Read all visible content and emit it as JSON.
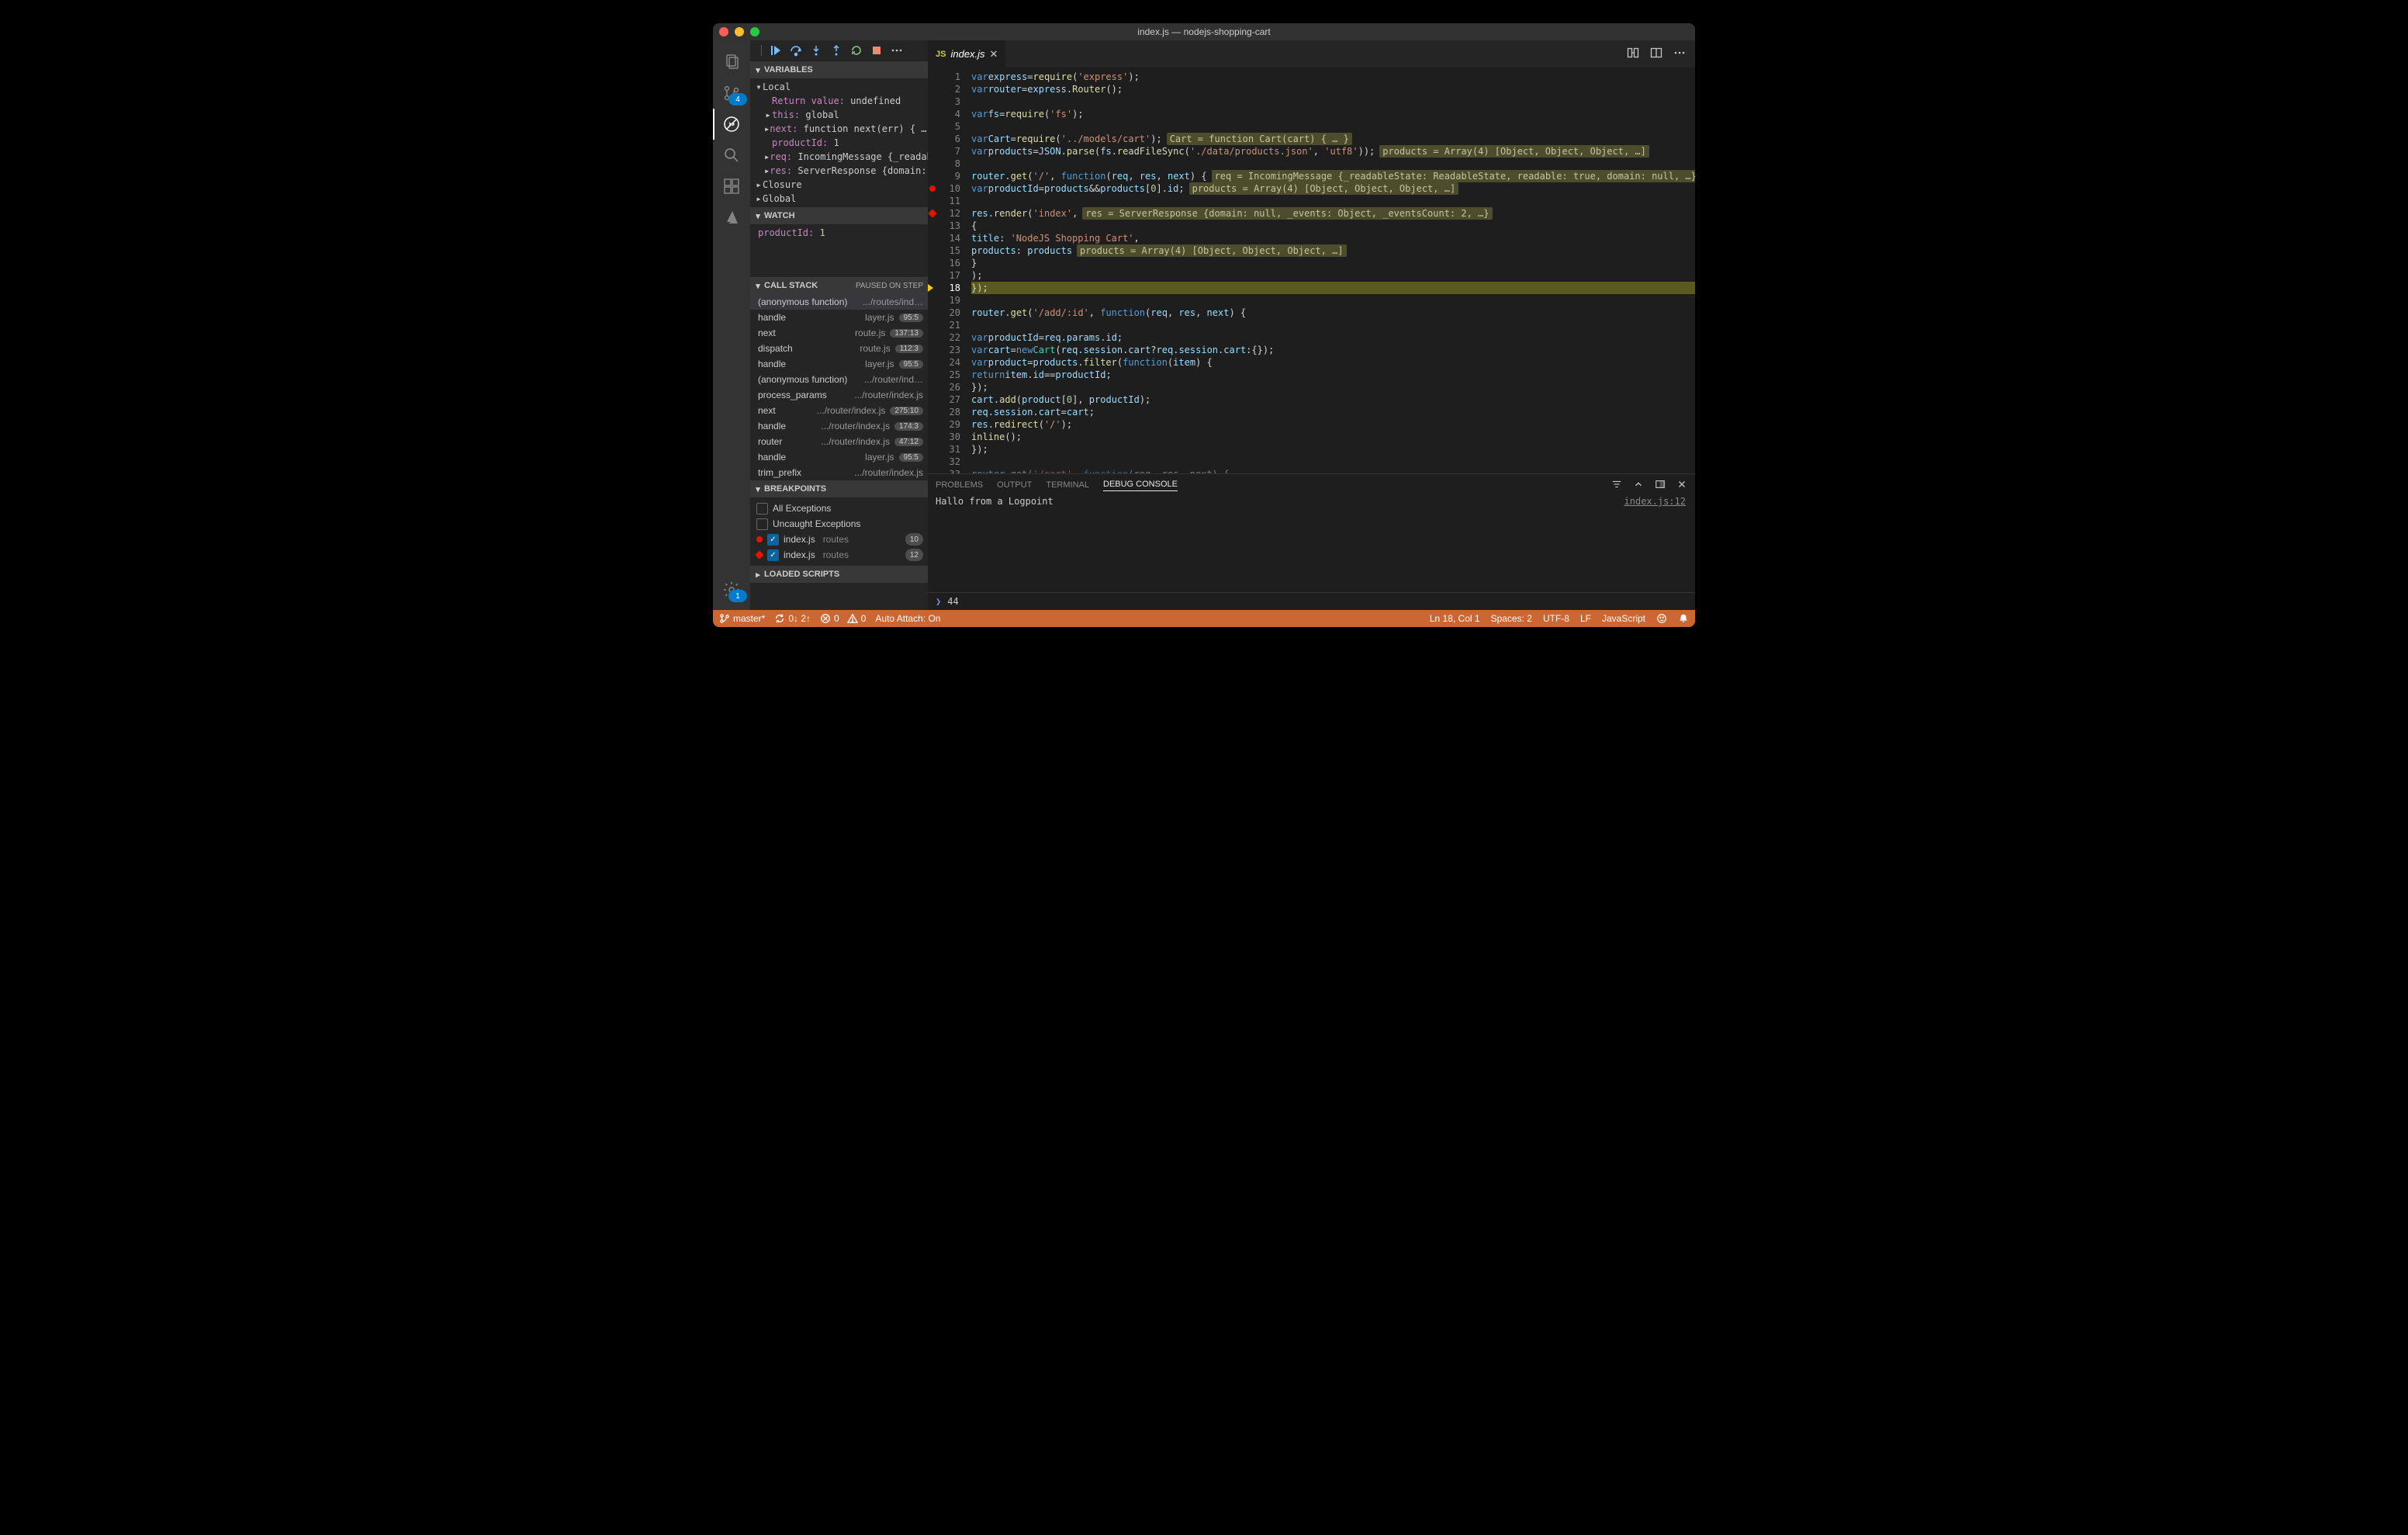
{
  "window": {
    "title": "index.js — nodejs-shopping-cart"
  },
  "activitybar": {
    "scm_badge": "4",
    "settings_badge": "1"
  },
  "sidebar": {
    "sections": {
      "variables": "VARIABLES",
      "watch": "WATCH",
      "callstack": "CALL STACK",
      "callstack_status": "PAUSED ON STEP",
      "breakpoints": "BREAKPOINTS",
      "loaded": "LOADED SCRIPTS"
    },
    "variables": {
      "scopes": [
        {
          "name": "Local",
          "expanded": true
        },
        {
          "name": "Closure",
          "expanded": false
        },
        {
          "name": "Global",
          "expanded": false
        }
      ],
      "local": [
        {
          "label": "Return value:",
          "value": "undefined"
        },
        {
          "label": "this:",
          "value": "global"
        },
        {
          "label": "next:",
          "value": "function next(err) { … }"
        },
        {
          "label": "productId:",
          "value": "1"
        },
        {
          "label": "req:",
          "value": "IncomingMessage {_readableSt…"
        },
        {
          "label": "res:",
          "value": "ServerResponse {domain: null…"
        }
      ]
    },
    "watch": [
      {
        "label": "productId:",
        "value": "1"
      }
    ],
    "callstack": [
      {
        "name": "(anonymous function)",
        "file": ".../routes/ind…",
        "pos": ""
      },
      {
        "name": "handle",
        "file": "layer.js",
        "pos": "95:5"
      },
      {
        "name": "next",
        "file": "route.js",
        "pos": "137:13"
      },
      {
        "name": "dispatch",
        "file": "route.js",
        "pos": "112:3"
      },
      {
        "name": "handle",
        "file": "layer.js",
        "pos": "95:5"
      },
      {
        "name": "(anonymous function)",
        "file": ".../router/ind…",
        "pos": ""
      },
      {
        "name": "process_params",
        "file": ".../router/index.js",
        "pos": ""
      },
      {
        "name": "next",
        "file": ".../router/index.js",
        "pos": "275:10"
      },
      {
        "name": "handle",
        "file": ".../router/index.js",
        "pos": "174:3"
      },
      {
        "name": "router",
        "file": ".../router/index.js",
        "pos": "47:12"
      },
      {
        "name": "handle",
        "file": "layer.js",
        "pos": "95:5"
      },
      {
        "name": "trim_prefix",
        "file": ".../router/index.js",
        "pos": ""
      }
    ],
    "breakpoints": {
      "allExceptions": "All Exceptions",
      "uncaught": "Uncaught Exceptions",
      "list": [
        {
          "file": "index.js",
          "dir": "routes",
          "line": "10",
          "shape": "circle"
        },
        {
          "file": "index.js",
          "dir": "routes",
          "line": "12",
          "shape": "diamond"
        }
      ]
    }
  },
  "tabs": {
    "active": "index.js"
  },
  "editor": {
    "current_line": 18,
    "lines": [
      {
        "n": 1,
        "html": "<span class='tok-kw'>var</span> <span class='tok-var'>express</span> <span class='tok-plain'>=</span> <span class='tok-fn'>require</span><span class='tok-plain'>(</span><span class='tok-str'>'express'</span><span class='tok-plain'>);</span>"
      },
      {
        "n": 2,
        "html": "<span class='tok-kw'>var</span> <span class='tok-var'>router</span> <span class='tok-plain'>=</span> <span class='tok-var'>express</span><span class='tok-plain'>.</span><span class='tok-fn'>Router</span><span class='tok-plain'>();</span>"
      },
      {
        "n": 3,
        "html": ""
      },
      {
        "n": 4,
        "html": "<span class='tok-kw'>var</span> <span class='tok-var'>fs</span> <span class='tok-plain'>=</span> <span class='tok-fn'>require</span><span class='tok-plain'>(</span><span class='tok-str'>'fs'</span><span class='tok-plain'>);</span>"
      },
      {
        "n": 5,
        "html": ""
      },
      {
        "n": 6,
        "html": "<span class='tok-kw'>var</span> <span class='tok-var'>Cart</span> <span class='tok-plain'>=</span> <span class='tok-fn'>require</span><span class='tok-plain'>(</span><span class='tok-str'>'../models/cart'</span><span class='tok-plain'>);</span> <span class='inlay'>Cart = function Cart(cart) { … }</span>"
      },
      {
        "n": 7,
        "html": "<span class='tok-kw'>var</span> <span class='tok-var'>products</span> <span class='tok-plain'>=</span> <span class='tok-var'>JSON</span><span class='tok-plain'>.</span><span class='tok-fn'>parse</span><span class='tok-plain'>(</span><span class='tok-var'>fs</span><span class='tok-plain'>.</span><span class='tok-fn'>readFileSync</span><span class='tok-plain'>(</span><span class='tok-str'>'./data/products.json'</span><span class='tok-plain'>, </span><span class='tok-str'>'utf8'</span><span class='tok-plain'>));</span> <span class='inlay'>products = Array(4) [Object, Object, Object, …]</span>"
      },
      {
        "n": 8,
        "html": ""
      },
      {
        "n": 9,
        "html": "<span class='tok-var'>router</span><span class='tok-plain'>.</span><span class='tok-fn'>get</span><span class='tok-plain'>(</span><span class='tok-str'>'/'</span><span class='tok-plain'>, </span><span class='tok-kw'>function</span> <span class='tok-plain'>(</span><span class='tok-var'>req</span><span class='tok-plain'>, </span><span class='tok-var'>res</span><span class='tok-plain'>, </span><span class='tok-var'>next</span><span class='tok-plain'>) {</span> <span class='inlay'>req = IncomingMessage {_readableState: ReadableState, readable: true, domain: null, …}, res = ServerRes…</span>"
      },
      {
        "n": 10,
        "bp": "circle",
        "html": "  <span class='tok-kw'>var</span> <span class='tok-var'>productId</span> <span class='tok-plain'>=</span> <span class='tok-var'>products</span> <span class='tok-plain'>&amp;&amp;</span> <span class='tok-var'>products</span><span class='tok-plain'>[</span><span class='tok-num'>0</span><span class='tok-plain'>].</span><span class='tok-prop'>id</span><span class='tok-plain'>;</span> <span class='inlay'>products = Array(4) [Object, Object, Object, …]</span>"
      },
      {
        "n": 11,
        "html": ""
      },
      {
        "n": 12,
        "bp": "diamond",
        "html": "  <span class='tok-var'>res</span><span class='tok-plain'>.</span><span class='tok-fn'>render</span><span class='tok-plain'>(</span><span class='tok-str'>'index'</span><span class='tok-plain'>,</span>  <span class='inlay'>res = ServerResponse {domain: null, _events: Object, _eventsCount: 2, …}</span>"
      },
      {
        "n": 13,
        "html": "    <span class='tok-plain'>{</span>"
      },
      {
        "n": 14,
        "html": "      <span class='tok-prop'>title</span><span class='tok-plain'>: </span><span class='tok-str'>'NodeJS Shopping Cart'</span><span class='tok-plain'>,</span>"
      },
      {
        "n": 15,
        "html": "      <span class='tok-prop'>products</span><span class='tok-plain'>: </span><span class='tok-var'>products</span> <span class='inlay'>products = Array(4) [Object, Object, Object, …]</span>"
      },
      {
        "n": 16,
        "html": "    <span class='tok-plain'>}</span>"
      },
      {
        "n": 17,
        "html": "  <span class='tok-plain'>);</span>"
      },
      {
        "n": 18,
        "html": "<span class='tok-plain'>});</span>",
        "current": true
      },
      {
        "n": 19,
        "html": ""
      },
      {
        "n": 20,
        "html": "<span class='tok-var'>router</span><span class='tok-plain'>.</span><span class='tok-fn'>get</span><span class='tok-plain'>(</span><span class='tok-str'>'/add/:id'</span><span class='tok-plain'>, </span><span class='tok-kw'>function</span><span class='tok-plain'>(</span><span class='tok-var'>req</span><span class='tok-plain'>, </span><span class='tok-var'>res</span><span class='tok-plain'>, </span><span class='tok-var'>next</span><span class='tok-plain'>) {</span>"
      },
      {
        "n": 21,
        "html": ""
      },
      {
        "n": 22,
        "html": "  <span class='tok-kw'>var</span> <span class='tok-var'>productId</span> <span class='tok-plain'>=</span> <span class='tok-var'>req</span><span class='tok-plain'>.</span><span class='tok-prop'>params</span><span class='tok-plain'>.</span><span class='tok-prop'>id</span><span class='tok-plain'>;</span>"
      },
      {
        "n": 23,
        "html": "  <span class='tok-kw'>var</span> <span class='tok-var'>cart</span> <span class='tok-plain'>=</span> <span class='tok-kw'>new</span> <span class='tok-type'>Cart</span><span class='tok-plain'>(</span><span class='tok-var'>req</span><span class='tok-plain'>.</span><span class='tok-prop'>session</span><span class='tok-plain'>.</span><span class='tok-prop'>cart</span> <span class='tok-plain'>?</span> <span class='tok-var'>req</span><span class='tok-plain'>.</span><span class='tok-prop'>session</span><span class='tok-plain'>.</span><span class='tok-prop'>cart</span> <span class='tok-plain'>:</span> <span class='tok-plain'>{});</span>"
      },
      {
        "n": 24,
        "html": "  <span class='tok-kw'>var</span> <span class='tok-var'>product</span> <span class='tok-plain'>=</span> <span class='tok-var'>products</span><span class='tok-plain'>.</span><span class='tok-fn'>filter</span><span class='tok-plain'>(</span><span class='tok-kw'>function</span><span class='tok-plain'>(</span><span class='tok-var'>item</span><span class='tok-plain'>) {</span>"
      },
      {
        "n": 25,
        "html": "    <span class='tok-kw'>return</span> <span class='tok-var'>item</span><span class='tok-plain'>.</span><span class='tok-prop'>id</span> <span class='tok-plain'>==</span> <span class='tok-var'>productId</span><span class='tok-plain'>;</span>"
      },
      {
        "n": 26,
        "html": "  <span class='tok-plain'>});</span>"
      },
      {
        "n": 27,
        "html": "  <span class='tok-var'>cart</span><span class='tok-plain'>.</span><span class='tok-fn'>add</span><span class='tok-plain'>(</span><span class='tok-var'>product</span><span class='tok-plain'>[</span><span class='tok-num'>0</span><span class='tok-plain'>], </span><span class='tok-var'>productId</span><span class='tok-plain'>);</span>"
      },
      {
        "n": 28,
        "html": "  <span class='tok-var'>req</span><span class='tok-plain'>.</span><span class='tok-prop'>session</span><span class='tok-plain'>.</span><span class='tok-prop'>cart</span> <span class='tok-plain'>=</span> <span class='tok-var'>cart</span><span class='tok-plain'>;</span>"
      },
      {
        "n": 29,
        "html": "  <span class='tok-var'>res</span><span class='tok-plain'>.</span><span class='tok-fn'>redirect</span><span class='tok-plain'>(</span><span class='tok-str'>'/'</span><span class='tok-plain'>);</span>"
      },
      {
        "n": 30,
        "html": "  <span class='tok-fn'>inline</span><span class='tok-plain'>();</span>"
      },
      {
        "n": 31,
        "html": "<span class='tok-plain'>});</span>"
      },
      {
        "n": 32,
        "html": ""
      },
      {
        "n": 33,
        "html": "<span class='tok-var' style='opacity:.5'>router</span><span class='tok-plain' style='opacity:.5'>.get(</span><span class='tok-str' style='opacity:.5'>'/cart'</span><span class='tok-plain' style='opacity:.5'>, </span><span class='tok-kw' style='opacity:.5'>function</span><span class='tok-plain' style='opacity:.5'>(req, res, next) {</span>"
      }
    ]
  },
  "panel": {
    "tabs": [
      "PROBLEMS",
      "OUTPUT",
      "TERMINAL",
      "DEBUG CONSOLE"
    ],
    "active": 3,
    "message": "Hallo from a Logpoint",
    "source": "index.js:12",
    "input": "44"
  },
  "statusbar": {
    "branch": "master*",
    "sync": "0↓ 2↑",
    "errors": "0",
    "warnings": "0",
    "autoattach": "Auto Attach: On",
    "lncol": "Ln 18, Col 1",
    "spaces": "Spaces: 2",
    "encoding": "UTF-8",
    "eol": "LF",
    "lang": "JavaScript"
  }
}
